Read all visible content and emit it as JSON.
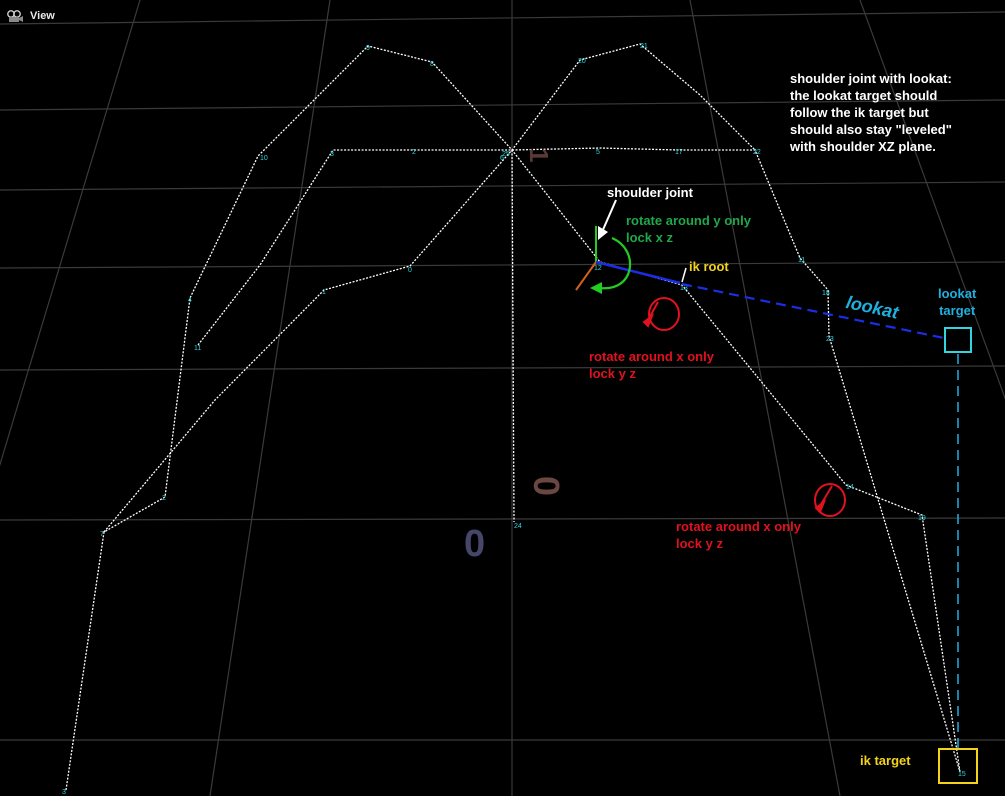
{
  "header": {
    "view_label": "View",
    "icon": "camera-icon"
  },
  "colors": {
    "grid": "#3a3a3a",
    "skeleton": "#ffffff",
    "joint_label": "#2fd6e0",
    "green": "#1fa84a",
    "yellow": "#f2d21b",
    "red": "#e0121f",
    "cyan": "#1fb0e0",
    "blue_line": "#1a2ee8"
  },
  "joint_labels": [
    "9",
    "8",
    "20",
    "21",
    "10",
    "3",
    "2",
    "25",
    "5",
    "17",
    "22",
    "11",
    "4",
    "1",
    "0",
    "12",
    "13",
    "18",
    "11",
    "23",
    "2",
    "14",
    "24",
    "7",
    "19",
    "3",
    "15",
    "6"
  ],
  "axis_marks": {
    "red_zero": "0",
    "blue_zero": "0",
    "red_one": "1"
  },
  "annotations": {
    "note_lines": [
      "shoulder joint with lookat:",
      "the lookat target should",
      "follow the ik target but",
      "should also stay \"leveled\"",
      "with shoulder XZ plane."
    ],
    "shoulder_joint": "shoulder joint",
    "rotate_y_line1": "rotate around y only",
    "rotate_y_line2": "lock x z",
    "ik_root": "ik root",
    "lookat": "lookat",
    "lookat_target_line1": "lookat",
    "lookat_target_line2": "target",
    "rotate_x1_line1": "rotate around x only",
    "rotate_x1_line2": "lock y z",
    "rotate_x2_line1": "rotate around x only",
    "rotate_x2_line2": "lock y z",
    "ik_target": "ik target"
  }
}
